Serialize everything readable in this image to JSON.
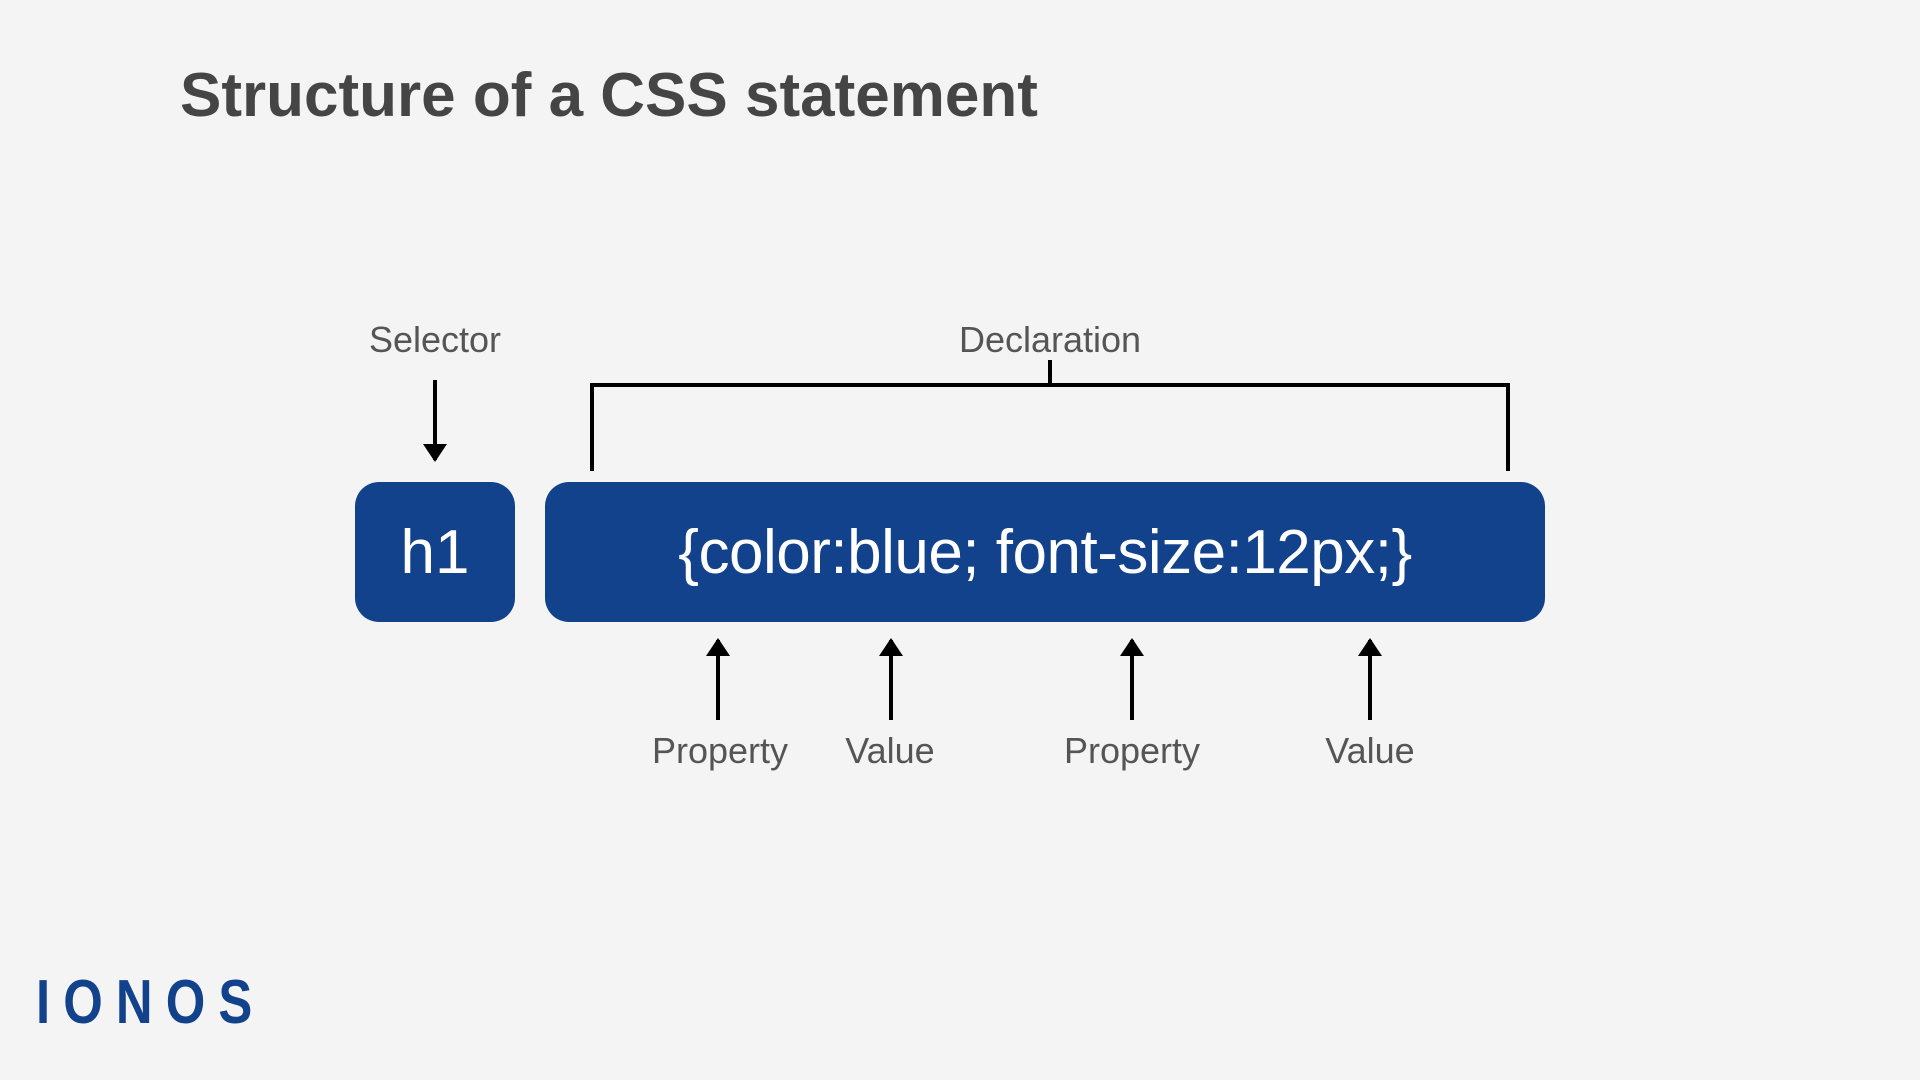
{
  "title": "Structure of a CSS statement",
  "labels": {
    "selector": "Selector",
    "declaration": "Declaration",
    "property1": "Property",
    "value1": "Value",
    "property2": "Property",
    "value2": "Value"
  },
  "code": {
    "selector": "h1",
    "declaration": "{color:blue; font-size:12px;}"
  },
  "brand": "IONOS",
  "colors": {
    "primary": "#12428b",
    "bg": "#f4f4f4",
    "text": "#454545",
    "label": "#555555"
  }
}
